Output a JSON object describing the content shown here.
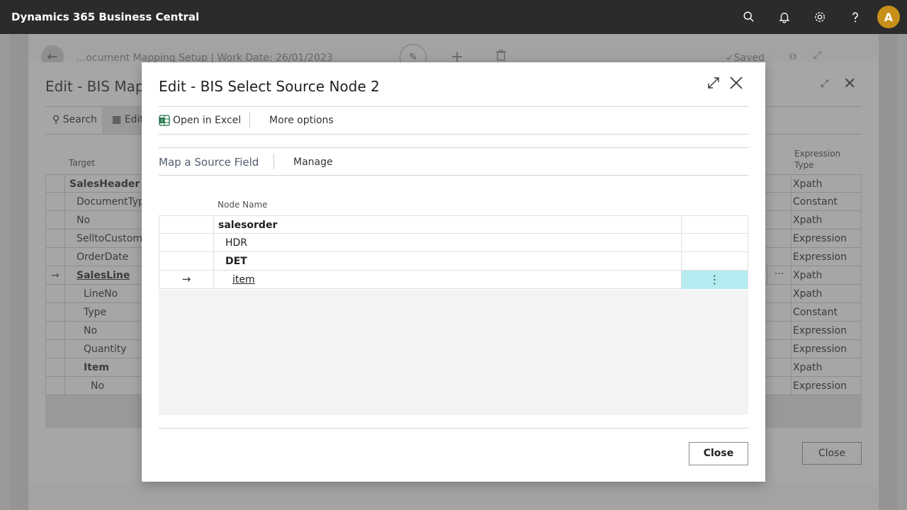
{
  "app": {
    "title": "Dynamics 365 Business Central",
    "avatar_initial": "A"
  },
  "background_page": {
    "breadcrumb_title": "...ocument Mapping Setup | Work Date: 26/01/2023",
    "saved_label": "Saved"
  },
  "mapping_dialog": {
    "title": "Edit - BIS Mapp",
    "search_label": "Search",
    "edit_label": "Edit",
    "target_header": "Target",
    "expression_type_header": "Expression Type",
    "rows": [
      {
        "target": "SalesHeader",
        "expr": "Xpath",
        "bold": true,
        "indent": 0,
        "current": false
      },
      {
        "target": "DocumentType",
        "expr": "Constant",
        "bold": false,
        "indent": 1,
        "current": false
      },
      {
        "target": "No",
        "expr": "Xpath",
        "bold": false,
        "indent": 1,
        "current": false
      },
      {
        "target": "SelltoCustomer",
        "expr": "Expression",
        "bold": false,
        "indent": 1,
        "current": false
      },
      {
        "target": "OrderDate",
        "expr": "Expression",
        "bold": false,
        "indent": 1,
        "current": false
      },
      {
        "target": "SalesLine",
        "expr": "Xpath",
        "bold": true,
        "indent": 1,
        "current": true
      },
      {
        "target": "LineNo",
        "expr": "Xpath",
        "bold": false,
        "indent": 2,
        "current": false
      },
      {
        "target": "Type",
        "expr": "Constant",
        "bold": false,
        "indent": 2,
        "current": false
      },
      {
        "target": "No",
        "expr": "Expression",
        "bold": false,
        "indent": 2,
        "current": false
      },
      {
        "target": "Quantity",
        "expr": "Expression",
        "bold": false,
        "indent": 2,
        "current": false
      },
      {
        "target": "Item",
        "expr": "Xpath",
        "bold": true,
        "indent": 2,
        "current": false
      },
      {
        "target": "No",
        "expr": "Expression",
        "bold": false,
        "indent": 3,
        "current": false
      }
    ],
    "close_label": "Close"
  },
  "source_dialog": {
    "title": "Edit - BIS Select Source Node 2",
    "open_in_excel_label": "Open in Excel",
    "more_options_label": "More options",
    "map_source_field_label": "Map a Source Field",
    "manage_label": "Manage",
    "node_name_header": "Node Name",
    "rows": [
      {
        "name": "salesorder",
        "bold": true,
        "indent": 0,
        "selected": false
      },
      {
        "name": "HDR",
        "bold": false,
        "indent": 1,
        "selected": false
      },
      {
        "name": "DET",
        "bold": true,
        "indent": 1,
        "selected": false
      },
      {
        "name": "item",
        "bold": false,
        "indent": 2,
        "selected": true
      }
    ],
    "close_label": "Close"
  }
}
